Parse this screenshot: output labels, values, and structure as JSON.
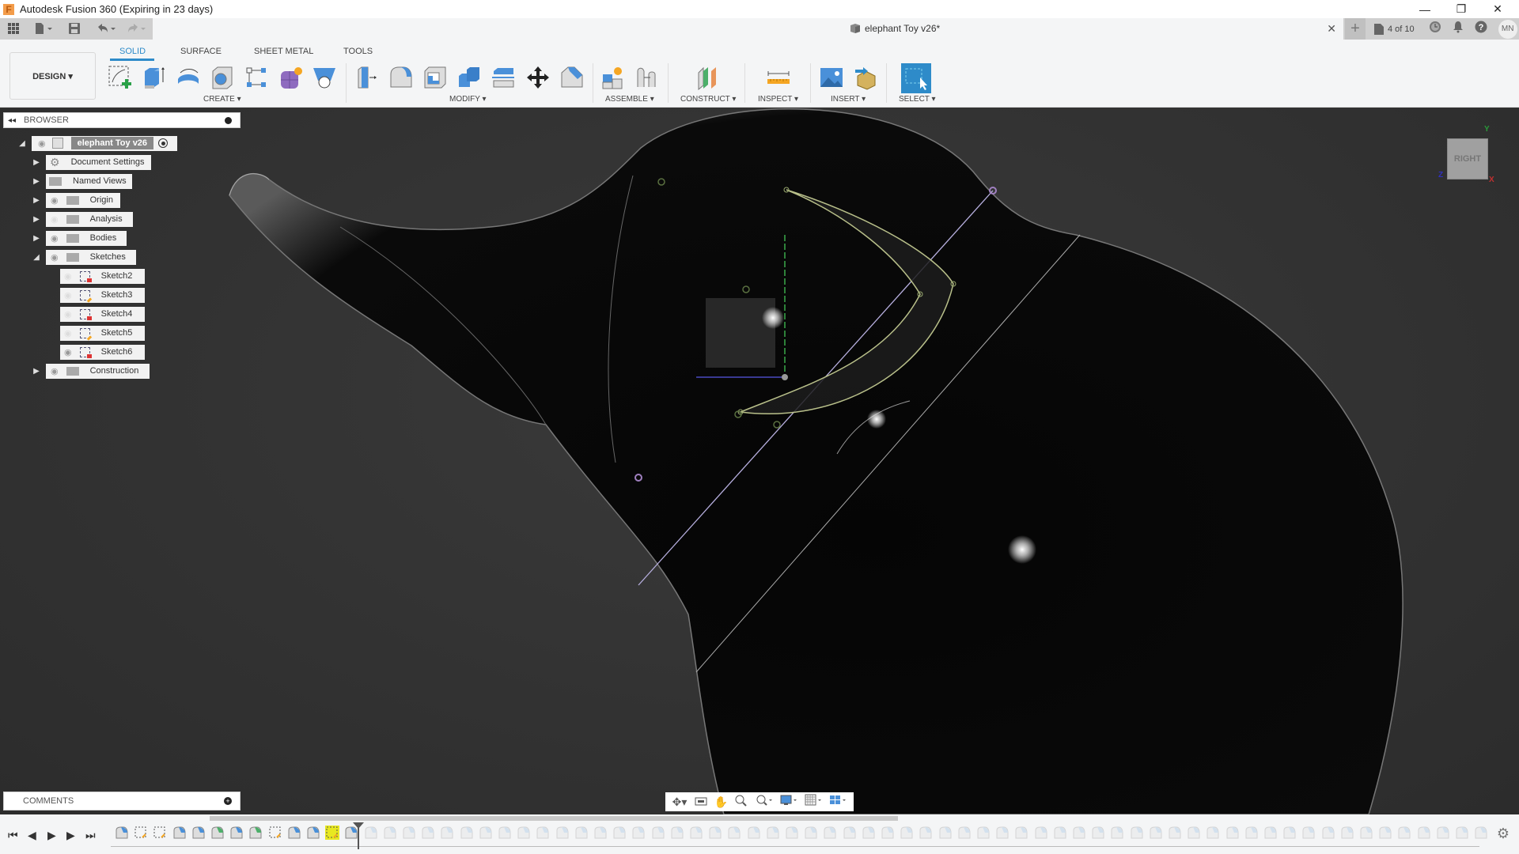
{
  "app": {
    "title": "Autodesk Fusion 360 (Expiring in 23 days)",
    "logo_letter": "F",
    "window_controls": {
      "minimize": "—",
      "restore": "❐",
      "close": "✕"
    }
  },
  "doc_tab": {
    "title": "elephant Toy v26*",
    "close": "✕"
  },
  "qat_right": {
    "new_tab": "+",
    "version_count": "4 of 10",
    "user_initials": "MN"
  },
  "ribbon": {
    "workspace": "DESIGN ▾",
    "tabs": [
      {
        "label": "SOLID",
        "active": true
      },
      {
        "label": "SURFACE",
        "active": false
      },
      {
        "label": "SHEET METAL",
        "active": false
      },
      {
        "label": "TOOLS",
        "active": false
      }
    ],
    "groups": {
      "create": "CREATE ▾",
      "modify": "MODIFY ▾",
      "assemble": "ASSEMBLE ▾",
      "construct": "CONSTRUCT ▾",
      "inspect": "INSPECT ▾",
      "insert": "INSERT ▾",
      "select": "SELECT ▾"
    },
    "accent": "#2e8bc9"
  },
  "browser": {
    "header": "BROWSER",
    "root": "elephant Toy v26",
    "items": [
      {
        "label": "Document Settings",
        "icon": "gear-icon"
      },
      {
        "label": "Named Views",
        "icon": "folder-icon"
      },
      {
        "label": "Origin",
        "icon": "folder-icon",
        "visible": true
      },
      {
        "label": "Analysis",
        "icon": "folder-icon",
        "visible": false
      },
      {
        "label": "Bodies",
        "icon": "folder-icon",
        "visible": true
      },
      {
        "label": "Sketches",
        "icon": "folder-icon",
        "visible": true,
        "expanded": true
      },
      {
        "label": "Construction",
        "icon": "folder-icon",
        "visible": true
      }
    ],
    "sketches": [
      {
        "label": "Sketch2",
        "visible": false,
        "state": "locked"
      },
      {
        "label": "Sketch3",
        "visible": false,
        "state": "edit"
      },
      {
        "label": "Sketch4",
        "visible": false,
        "state": "locked"
      },
      {
        "label": "Sketch5",
        "visible": false,
        "state": "edit"
      },
      {
        "label": "Sketch6",
        "visible": true,
        "state": "locked"
      }
    ]
  },
  "comments": {
    "header": "COMMENTS"
  },
  "viewcube": {
    "face": "RIGHT",
    "axis_y": "Y",
    "axis_x": "X",
    "axis_z": "Z"
  },
  "timeline": {
    "controls": [
      "⏮",
      "◀",
      "▶",
      "▶",
      "⏭"
    ]
  }
}
